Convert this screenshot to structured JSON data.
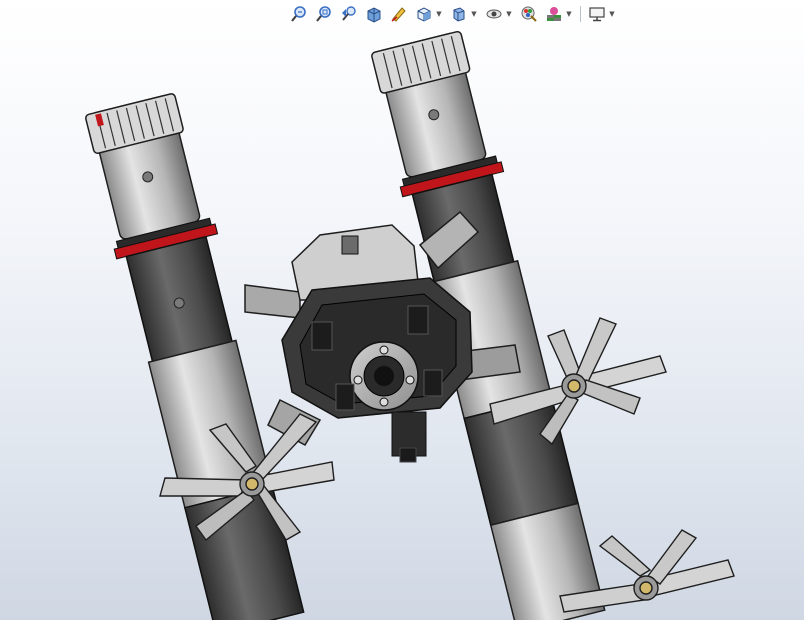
{
  "toolbar": {
    "buttons": [
      {
        "icon": "zoom-to-fit-icon"
      },
      {
        "icon": "zoom-to-area-icon"
      },
      {
        "icon": "previous-view-icon"
      },
      {
        "icon": "section-view-icon"
      },
      {
        "icon": "dynamic-annotation-icon"
      },
      {
        "icon": "view-orientation-icon",
        "dropdown": true
      },
      {
        "icon": "display-style-icon",
        "dropdown": true
      },
      {
        "icon": "hide-show-items-icon",
        "dropdown": true
      },
      {
        "icon": "edit-appearance-icon"
      },
      {
        "icon": "apply-scene-icon",
        "dropdown": true
      },
      {
        "icon": "view-settings-icon",
        "dropdown": true
      }
    ]
  },
  "colors": {
    "background_top": "#ffffff",
    "background_bottom": "#cfd7e3",
    "body_light": "#c9c9c9",
    "body_dark": "#4a4a4a",
    "accent_red": "#c0161b",
    "edge": "#1e1e1e",
    "toolbar_blue": "#3b6fc4"
  }
}
